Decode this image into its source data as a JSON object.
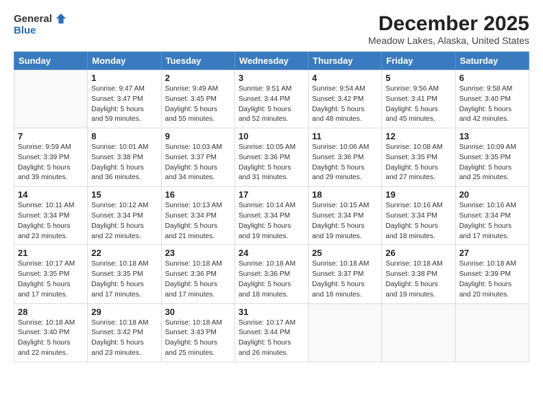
{
  "logo": {
    "general": "General",
    "blue": "Blue"
  },
  "header": {
    "month": "December 2025",
    "location": "Meadow Lakes, Alaska, United States"
  },
  "weekdays": [
    "Sunday",
    "Monday",
    "Tuesday",
    "Wednesday",
    "Thursday",
    "Friday",
    "Saturday"
  ],
  "weeks": [
    [
      {
        "day": "",
        "content": ""
      },
      {
        "day": "1",
        "content": "Sunrise: 9:47 AM\nSunset: 3:47 PM\nDaylight: 5 hours\nand 59 minutes."
      },
      {
        "day": "2",
        "content": "Sunrise: 9:49 AM\nSunset: 3:45 PM\nDaylight: 5 hours\nand 55 minutes."
      },
      {
        "day": "3",
        "content": "Sunrise: 9:51 AM\nSunset: 3:44 PM\nDaylight: 5 hours\nand 52 minutes."
      },
      {
        "day": "4",
        "content": "Sunrise: 9:54 AM\nSunset: 3:42 PM\nDaylight: 5 hours\nand 48 minutes."
      },
      {
        "day": "5",
        "content": "Sunrise: 9:56 AM\nSunset: 3:41 PM\nDaylight: 5 hours\nand 45 minutes."
      },
      {
        "day": "6",
        "content": "Sunrise: 9:58 AM\nSunset: 3:40 PM\nDaylight: 5 hours\nand 42 minutes."
      }
    ],
    [
      {
        "day": "7",
        "content": "Sunrise: 9:59 AM\nSunset: 3:39 PM\nDaylight: 5 hours\nand 39 minutes."
      },
      {
        "day": "8",
        "content": "Sunrise: 10:01 AM\nSunset: 3:38 PM\nDaylight: 5 hours\nand 36 minutes."
      },
      {
        "day": "9",
        "content": "Sunrise: 10:03 AM\nSunset: 3:37 PM\nDaylight: 5 hours\nand 34 minutes."
      },
      {
        "day": "10",
        "content": "Sunrise: 10:05 AM\nSunset: 3:36 PM\nDaylight: 5 hours\nand 31 minutes."
      },
      {
        "day": "11",
        "content": "Sunrise: 10:06 AM\nSunset: 3:36 PM\nDaylight: 5 hours\nand 29 minutes."
      },
      {
        "day": "12",
        "content": "Sunrise: 10:08 AM\nSunset: 3:35 PM\nDaylight: 5 hours\nand 27 minutes."
      },
      {
        "day": "13",
        "content": "Sunrise: 10:09 AM\nSunset: 3:35 PM\nDaylight: 5 hours\nand 25 minutes."
      }
    ],
    [
      {
        "day": "14",
        "content": "Sunrise: 10:11 AM\nSunset: 3:34 PM\nDaylight: 5 hours\nand 23 minutes."
      },
      {
        "day": "15",
        "content": "Sunrise: 10:12 AM\nSunset: 3:34 PM\nDaylight: 5 hours\nand 22 minutes."
      },
      {
        "day": "16",
        "content": "Sunrise: 10:13 AM\nSunset: 3:34 PM\nDaylight: 5 hours\nand 21 minutes."
      },
      {
        "day": "17",
        "content": "Sunrise: 10:14 AM\nSunset: 3:34 PM\nDaylight: 5 hours\nand 19 minutes."
      },
      {
        "day": "18",
        "content": "Sunrise: 10:15 AM\nSunset: 3:34 PM\nDaylight: 5 hours\nand 19 minutes."
      },
      {
        "day": "19",
        "content": "Sunrise: 10:16 AM\nSunset: 3:34 PM\nDaylight: 5 hours\nand 18 minutes."
      },
      {
        "day": "20",
        "content": "Sunrise: 10:16 AM\nSunset: 3:34 PM\nDaylight: 5 hours\nand 17 minutes."
      }
    ],
    [
      {
        "day": "21",
        "content": "Sunrise: 10:17 AM\nSunset: 3:35 PM\nDaylight: 5 hours\nand 17 minutes."
      },
      {
        "day": "22",
        "content": "Sunrise: 10:18 AM\nSunset: 3:35 PM\nDaylight: 5 hours\nand 17 minutes."
      },
      {
        "day": "23",
        "content": "Sunrise: 10:18 AM\nSunset: 3:36 PM\nDaylight: 5 hours\nand 17 minutes."
      },
      {
        "day": "24",
        "content": "Sunrise: 10:18 AM\nSunset: 3:36 PM\nDaylight: 5 hours\nand 18 minutes."
      },
      {
        "day": "25",
        "content": "Sunrise: 10:18 AM\nSunset: 3:37 PM\nDaylight: 5 hours\nand 18 minutes."
      },
      {
        "day": "26",
        "content": "Sunrise: 10:18 AM\nSunset: 3:38 PM\nDaylight: 5 hours\nand 19 minutes."
      },
      {
        "day": "27",
        "content": "Sunrise: 10:18 AM\nSunset: 3:39 PM\nDaylight: 5 hours\nand 20 minutes."
      }
    ],
    [
      {
        "day": "28",
        "content": "Sunrise: 10:18 AM\nSunset: 3:40 PM\nDaylight: 5 hours\nand 22 minutes."
      },
      {
        "day": "29",
        "content": "Sunrise: 10:18 AM\nSunset: 3:42 PM\nDaylight: 5 hours\nand 23 minutes."
      },
      {
        "day": "30",
        "content": "Sunrise: 10:18 AM\nSunset: 3:43 PM\nDaylight: 5 hours\nand 25 minutes."
      },
      {
        "day": "31",
        "content": "Sunrise: 10:17 AM\nSunset: 3:44 PM\nDaylight: 5 hours\nand 26 minutes."
      },
      {
        "day": "",
        "content": ""
      },
      {
        "day": "",
        "content": ""
      },
      {
        "day": "",
        "content": ""
      }
    ]
  ]
}
